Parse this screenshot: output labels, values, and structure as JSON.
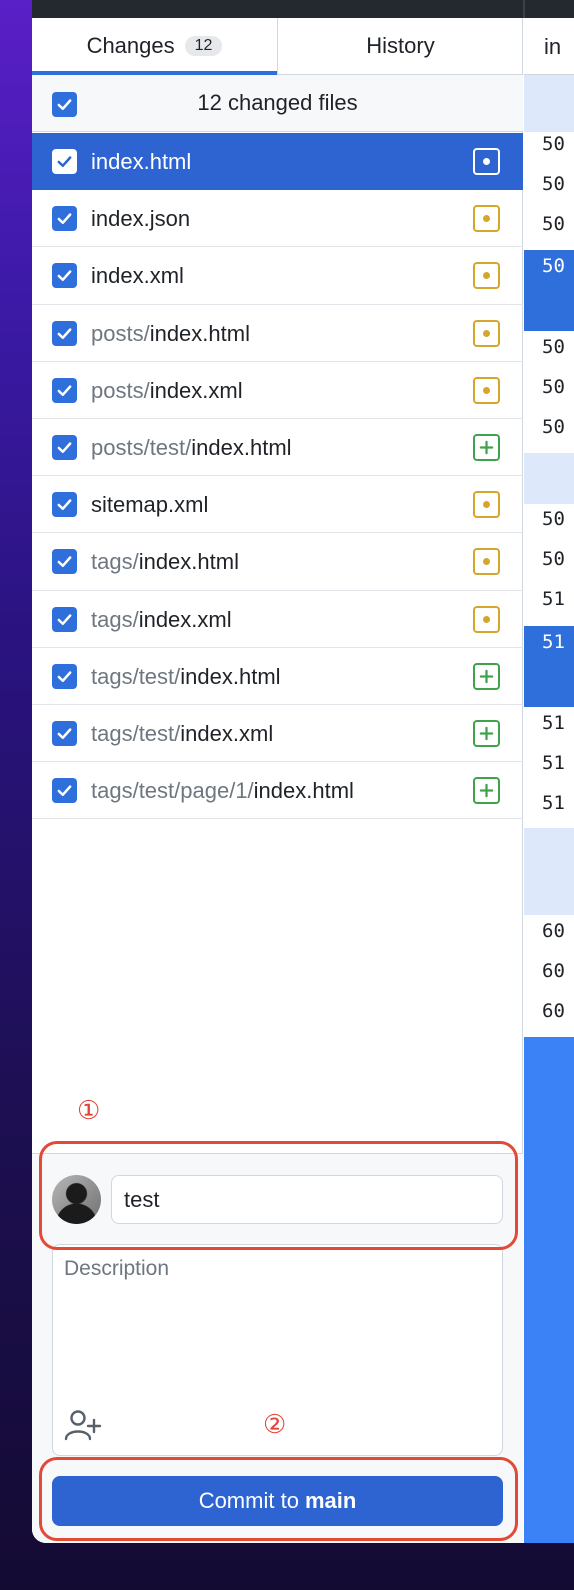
{
  "tabs": {
    "changes_label": "Changes",
    "changes_count": "12",
    "history_label": "History"
  },
  "summary": {
    "text": "12 changed files"
  },
  "files": [
    {
      "dir": "",
      "name": "index.html",
      "status": "modified",
      "selected": true
    },
    {
      "dir": "",
      "name": "index.json",
      "status": "modified"
    },
    {
      "dir": "",
      "name": "index.xml",
      "status": "modified"
    },
    {
      "dir": "posts/",
      "name": "index.html",
      "status": "modified"
    },
    {
      "dir": "posts/",
      "name": "index.xml",
      "status": "modified"
    },
    {
      "dir": "posts/test/",
      "name": "index.html",
      "status": "added"
    },
    {
      "dir": "",
      "name": "sitemap.xml",
      "status": "modified"
    },
    {
      "dir": "tags/",
      "name": "index.html",
      "status": "modified"
    },
    {
      "dir": "tags/",
      "name": "index.xml",
      "status": "modified"
    },
    {
      "dir": "tags/test/",
      "name": "index.html",
      "status": "added"
    },
    {
      "dir": "tags/test/",
      "name": "index.xml",
      "status": "added"
    },
    {
      "dir": "tags/test/page/1/",
      "name": "index.html",
      "status": "added"
    }
  ],
  "annotations": {
    "one": "①",
    "two": "②"
  },
  "commit": {
    "summary_value": "test",
    "description_placeholder": "Description",
    "button_prefix": "Commit to",
    "branch": "main"
  },
  "diff": {
    "tab_label": "in",
    "line_numbers": [
      "50",
      "50",
      "50",
      "50",
      "50",
      "50",
      "50",
      "50",
      "50",
      "51",
      "51",
      "51",
      "51",
      "51",
      "60",
      "60",
      "60"
    ]
  },
  "colors": {
    "accent": "#2f6fdb",
    "modified": "#d4a72c",
    "added": "#3fa34d",
    "annotation": "#e24a37"
  }
}
